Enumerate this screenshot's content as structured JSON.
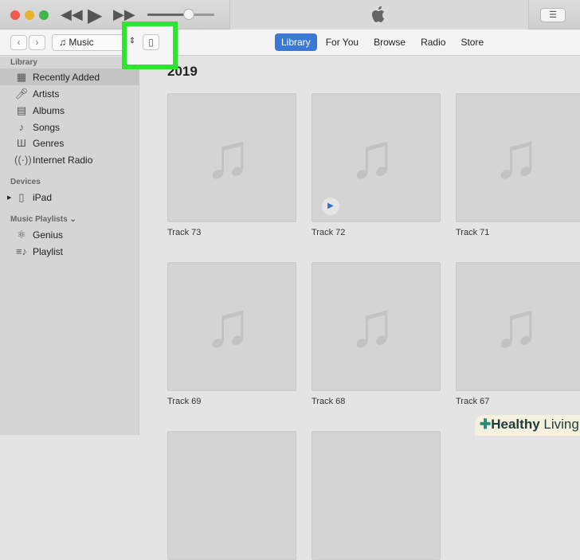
{
  "window": {
    "source_selector": "Music"
  },
  "tabs": [
    {
      "label": "Library",
      "active": true
    },
    {
      "label": "For You"
    },
    {
      "label": "Browse"
    },
    {
      "label": "Radio"
    },
    {
      "label": "Store"
    }
  ],
  "sidebar": {
    "library_heading": "Library",
    "library": [
      {
        "label": "Recently Added",
        "icon": "grid-icon",
        "selected": true
      },
      {
        "label": "Artists",
        "icon": "microphone-icon"
      },
      {
        "label": "Albums",
        "icon": "album-icon"
      },
      {
        "label": "Songs",
        "icon": "music-note-icon"
      },
      {
        "label": "Genres",
        "icon": "genres-icon"
      },
      {
        "label": "Internet Radio",
        "icon": "antenna-icon"
      }
    ],
    "devices_heading": "Devices",
    "devices": [
      {
        "label": "iPad",
        "icon": "ipad-icon"
      }
    ],
    "playlists_heading": "Music Playlists",
    "playlists": [
      {
        "label": "Genius",
        "icon": "atom-icon"
      },
      {
        "label": "Playlist",
        "icon": "playlist-icon"
      }
    ]
  },
  "main": {
    "year": "2019",
    "tracks": [
      "Track 73",
      "Track 72",
      "Track 71",
      "Track 69",
      "Track 68",
      "Track 67"
    ]
  },
  "watermark": {
    "text1": "Healthy",
    "text2": "Living"
  },
  "colors": {
    "accent": "#3a78d6",
    "highlight": "#2be62b"
  }
}
